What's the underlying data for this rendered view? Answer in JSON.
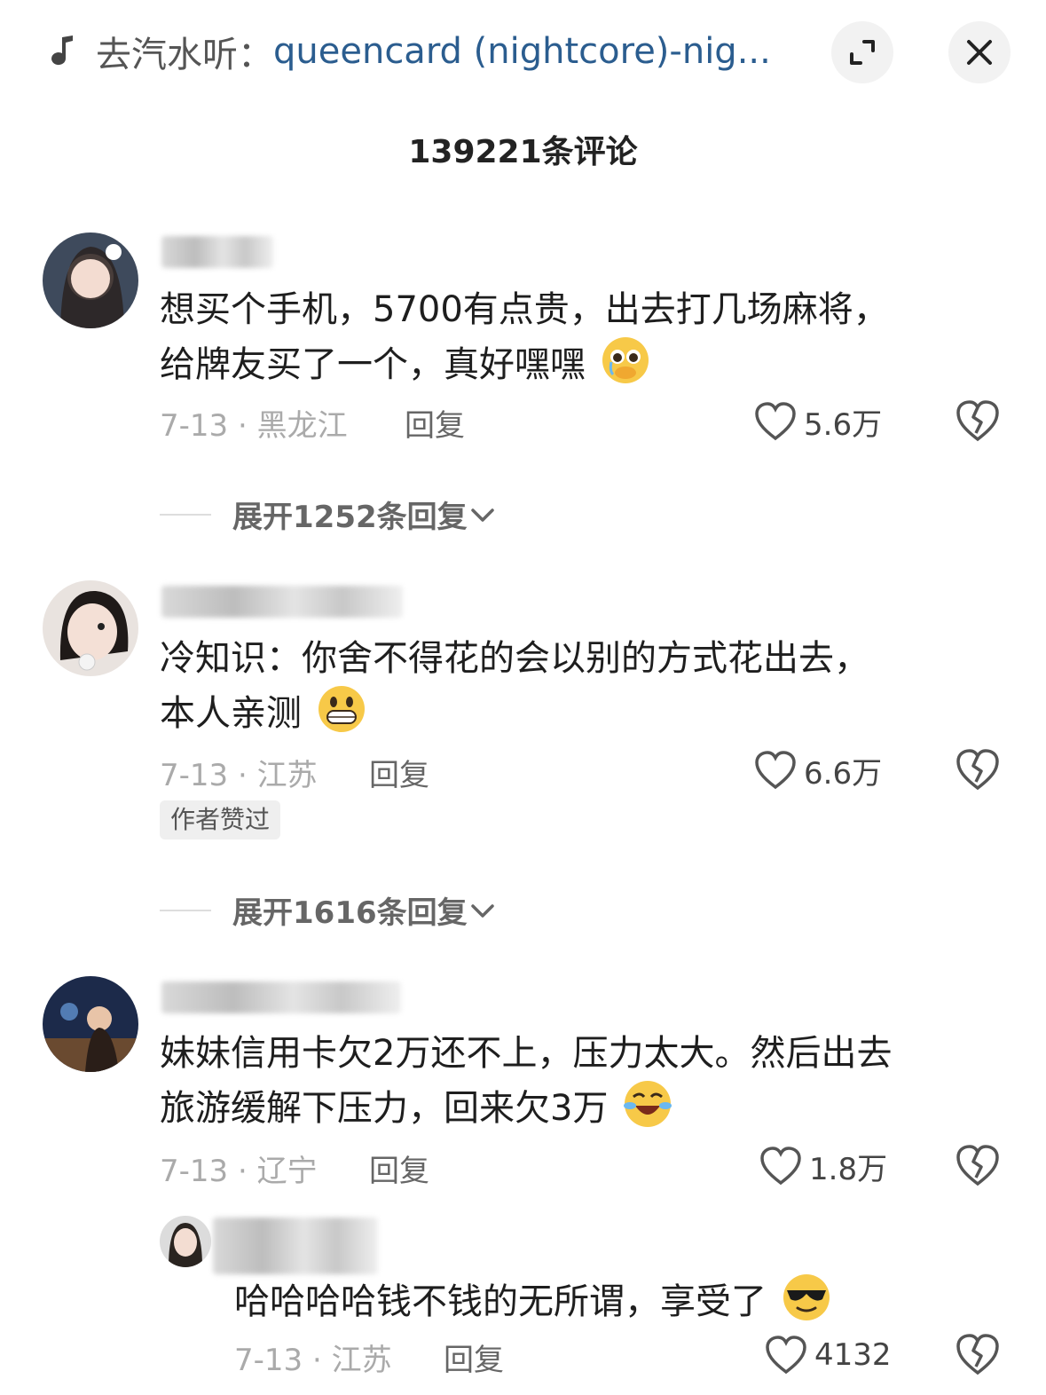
{
  "header": {
    "music_prefix": "去汽水听：",
    "music_title": "queencard (nightcore)-nig...",
    "comment_count_title": "139221条评论"
  },
  "comments": [
    {
      "text_line1": "想买个手机，5700有点贵，出去打几场麻将，",
      "text_line2": "给牌友买了一个，真好嘿嘿",
      "emoji": "pleading-face-icon",
      "date_location": "7-13 · 黑龙江",
      "reply_label": "回复",
      "likes": "5.6万",
      "expand_label": "展开1252条回复"
    },
    {
      "text_line1": "冷知识：你舍不得花的会以别的方式花出去，",
      "text_line2": "本人亲测",
      "emoji": "grinning-face-icon",
      "date_location": "7-13 · 江苏",
      "reply_label": "回复",
      "likes": "6.6万",
      "badge": "作者赞过",
      "expand_label": "展开1616条回复"
    },
    {
      "text_line1": "妹妹信用卡欠2万还不上，压力太大。然后出去",
      "text_line2": "旅游缓解下压力，回来欠3万",
      "emoji": "tears-of-joy-icon",
      "date_location": "7-13 · 辽宁",
      "reply_label": "回复",
      "likes": "1.8万"
    }
  ],
  "reply": {
    "text": "哈哈哈哈钱不钱的无所谓，享受了",
    "emoji": "sunglasses-face-icon",
    "date_location": "7-13 · 江苏",
    "reply_label": "回复",
    "likes": "4132"
  },
  "colors": {
    "link_blue": "#2b5d8f",
    "meta_gray": "#aaaaaa",
    "badge_bg": "#efefef"
  }
}
